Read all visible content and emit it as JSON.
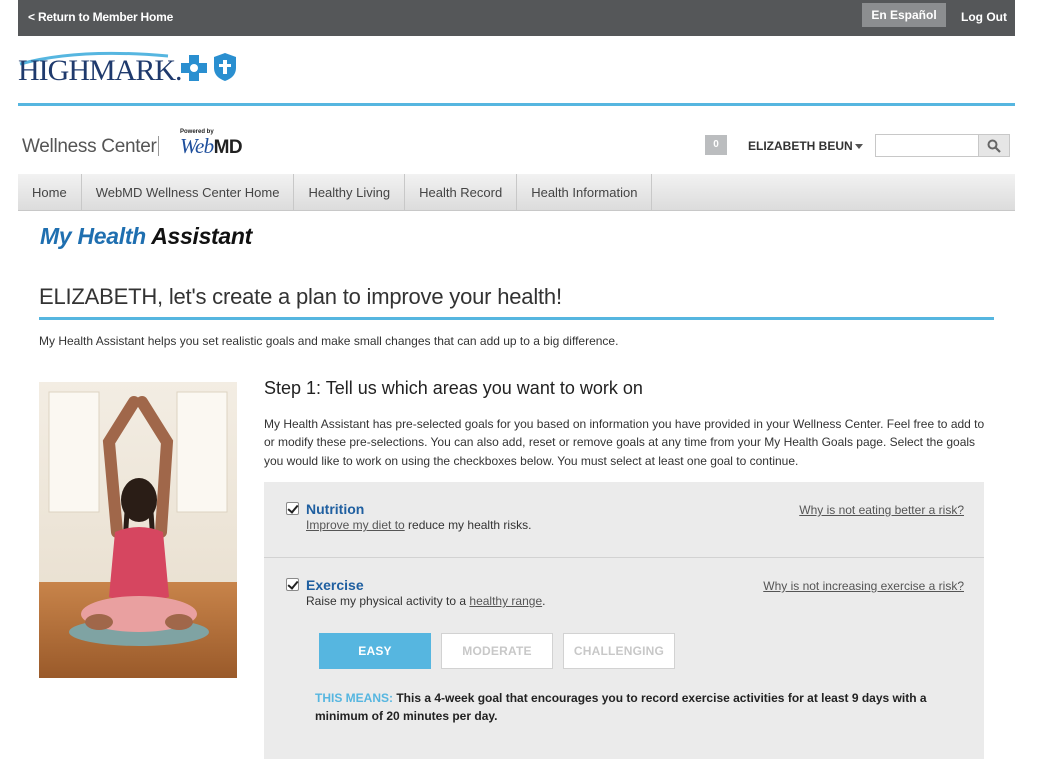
{
  "topbar": {
    "return_label": "< Return to Member Home",
    "espanol_label": "En Español",
    "logout_label": "Log Out"
  },
  "brand": {
    "logo_text": "HIGHMARK.",
    "wellness_label": "Wellness Center",
    "powered_by": "Powered by",
    "webmd_web": "Web",
    "webmd_md": "MD"
  },
  "header": {
    "message_count": "0",
    "user_name": "ELIZABETH BEUN",
    "search_placeholder": ""
  },
  "nav": {
    "items": [
      "Home",
      "WebMD Wellness Center Home",
      "Healthy Living",
      "Health Record",
      "Health Information"
    ]
  },
  "main": {
    "title_my_health": "My Health",
    "title_assistant": "Assistant",
    "headline": "ELIZABETH, let's create a plan to improve your health!",
    "intro": "My Health Assistant helps you set realistic goals and make small changes that can add up to a big difference.",
    "step_title": "Step 1: Tell us which areas you want to work on",
    "step_body": "My Health Assistant has pre-selected goals for you based on information you have provided in your Wellness Center. Feel free to add to or modify these pre-selections. You can also add, reset or remove goals at any time from your My Health Goals page. Select the goals you would like to work on using the checkboxes below. You must select at least one goal to continue."
  },
  "goals": {
    "nutrition": {
      "name": "Nutrition",
      "desc_link": "Improve my diet to",
      "desc_rest": " reduce my health risks.",
      "risk_link": "Why is not eating better a risk?",
      "checked": true
    },
    "exercise": {
      "name": "Exercise",
      "desc_start": "Raise my physical activity to a ",
      "desc_link": "healthy range",
      "desc_end": ".",
      "risk_link": "Why is not increasing exercise a risk?",
      "checked": true,
      "levels": [
        "EASY",
        "MODERATE",
        "CHALLENGING"
      ],
      "selected_level": "EASY",
      "means_label": "THIS MEANS:",
      "means_text": " This a 4-week goal that encourages you to record exercise activities for at least 9 days with a minimum of 20 minutes per day."
    }
  },
  "colors": {
    "accent_blue": "#56b6e0",
    "link_blue": "#1f5fa0",
    "topbar_gray": "#555759"
  }
}
